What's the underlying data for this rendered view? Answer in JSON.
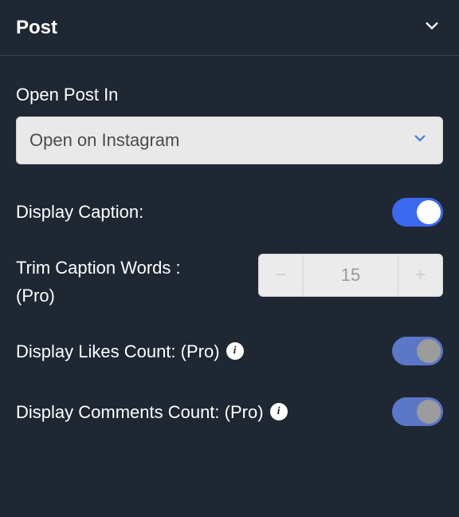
{
  "panel": {
    "title": "Post"
  },
  "open_post_in": {
    "label": "Open Post In",
    "selected": "Open on Instagram"
  },
  "display_caption": {
    "label": "Display Caption:",
    "value": true
  },
  "trim_caption": {
    "label_line1": "Trim Caption Words :",
    "label_line2": "(Pro)",
    "value": "15"
  },
  "display_likes": {
    "label": "Display Likes Count: (Pro)",
    "value": true
  },
  "display_comments": {
    "label": "Display Comments Count: (Pro)",
    "value": true
  }
}
